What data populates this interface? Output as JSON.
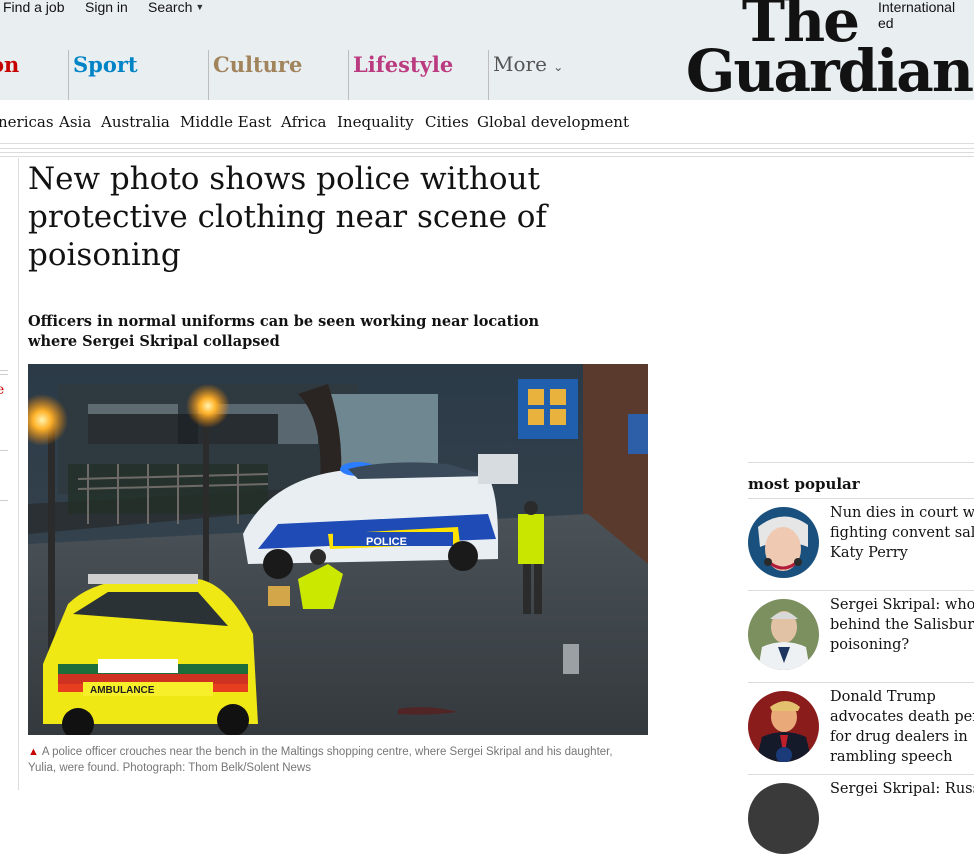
{
  "header": {
    "util_links": [
      "Find a job",
      "Sign in",
      "Search"
    ],
    "edition": "International ed",
    "logo_line1": "The",
    "logo_line2": "Guardian",
    "pillars": [
      {
        "label": "on",
        "color": "#c70000"
      },
      {
        "label": "Sport",
        "color": "#0084c6"
      },
      {
        "label": "Culture",
        "color": "#a1845c"
      },
      {
        "label": "Lifestyle",
        "color": "#bb3b80"
      },
      {
        "label": "More",
        "color": "#555555"
      }
    ]
  },
  "subnav": [
    "nericas",
    "Asia",
    "Australia",
    "Middle East",
    "Africa",
    "Inequality",
    "Cities",
    "Global development"
  ],
  "left_fragment": "e",
  "article": {
    "headline": "New photo shows police without protective clothing near scene of poisoning",
    "standfirst": "Officers in normal uniforms can be seen working near location where Sergei Skripal collapsed",
    "caption": "A police officer crouches near the bench in the Maltings shopping centre, where Sergei Skripal and his daughter, Yulia, were found. Photograph: Thom Belk/Solent News",
    "photo_text": {
      "police": "POLICE",
      "ambulance": "AMBULANCE"
    }
  },
  "most_popular": {
    "heading": "most popular",
    "items": [
      {
        "title": "Nun dies in court while fighting convent sale to Katy Perry"
      },
      {
        "title": "Sergei Skripal: who was behind the Salisbury poisoning?"
      },
      {
        "title": "Donald Trump advocates death penalty for drug dealers in rambling speech"
      },
      {
        "title": "Sergei Skripal: Russia"
      }
    ]
  }
}
